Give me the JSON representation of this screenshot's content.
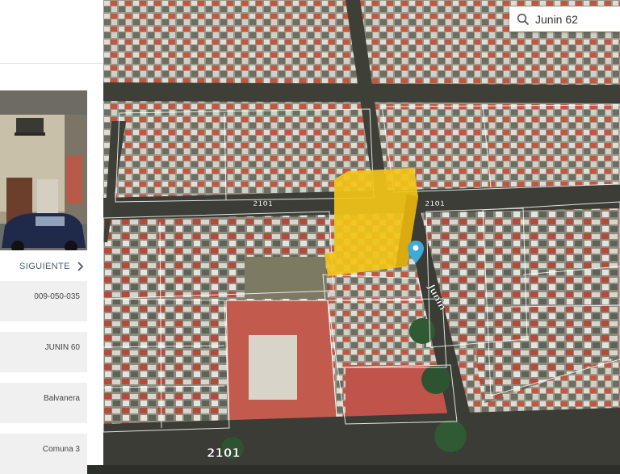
{
  "search": {
    "value": "Junin 62"
  },
  "panel": {
    "next_label": "SIGUIENTE",
    "fields": [
      {
        "value": "009-050-035"
      },
      {
        "value": "JUNIN 60"
      },
      {
        "value": "Balvanera"
      },
      {
        "value": "Comuna 3"
      }
    ]
  },
  "map": {
    "street_labels": [
      "2101",
      "2101",
      "2101",
      "Junin"
    ],
    "highlight_color": "#f2c418",
    "pin_color": "#3fa9d8"
  }
}
